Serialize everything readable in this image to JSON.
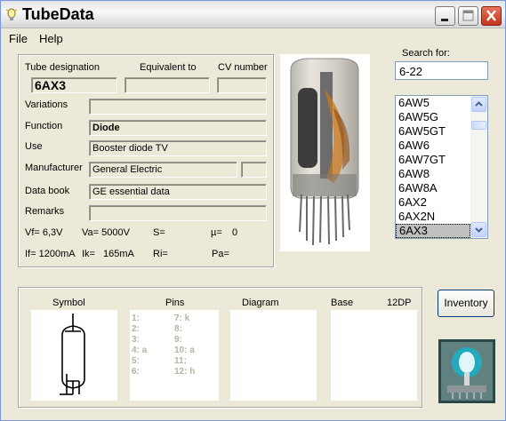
{
  "window": {
    "title": "TubeData"
  },
  "menu": {
    "file": "File",
    "help": "Help"
  },
  "form": {
    "tube_designation_label": "Tube designation",
    "equivalent_label": "Equivalent to",
    "cv_label": "CV number",
    "tube_designation": "6AX3",
    "equivalent": "",
    "cv_number": "",
    "variations_label": "Variations",
    "variations": "",
    "function_label": "Function",
    "function": "Diode",
    "use_label": "Use",
    "use": "Booster diode TV",
    "manufacturer_label": "Manufacturer",
    "manufacturer": "General Electric",
    "manufacturer_code": "",
    "databook_label": "Data book",
    "databook": "GE essential data",
    "remarks_label": "Remarks",
    "remarks": "",
    "params": {
      "vf": "Vf= 6,3V",
      "va": "Va= 5000V",
      "s": "S=",
      "mu": "µ=",
      "mu_val": "0",
      "if": "If= 1200mA",
      "ik": "Ik=",
      "ik_val": "165mA",
      "ri": "Ri=",
      "pa": "Pa="
    }
  },
  "search": {
    "label": "Search for:",
    "value": "6-22"
  },
  "tube_list": [
    "6AW5",
    "6AW5G",
    "6AW5GT",
    "6AW6",
    "6AW7GT",
    "6AW8",
    "6AW8A",
    "6AX2",
    "6AX2N",
    "6AX3"
  ],
  "tube_list_selected": "6AX3",
  "lower": {
    "symbol_label": "Symbol",
    "pins_label": "Pins",
    "diagram_label": "Diagram",
    "base_label": "Base",
    "base_value": "12DP",
    "pins_left": [
      "1:",
      "2:",
      "3:",
      "4: a",
      "5:",
      "6:"
    ],
    "pins_right": [
      "7: k",
      "8:",
      "9:",
      "10: a",
      "11:",
      "12: h"
    ]
  },
  "inventory_label": "Inventory",
  "colors": {
    "selection": "#c0c0c0",
    "close_button": "#d14a30",
    "pin_text": "#b4b4a0"
  }
}
